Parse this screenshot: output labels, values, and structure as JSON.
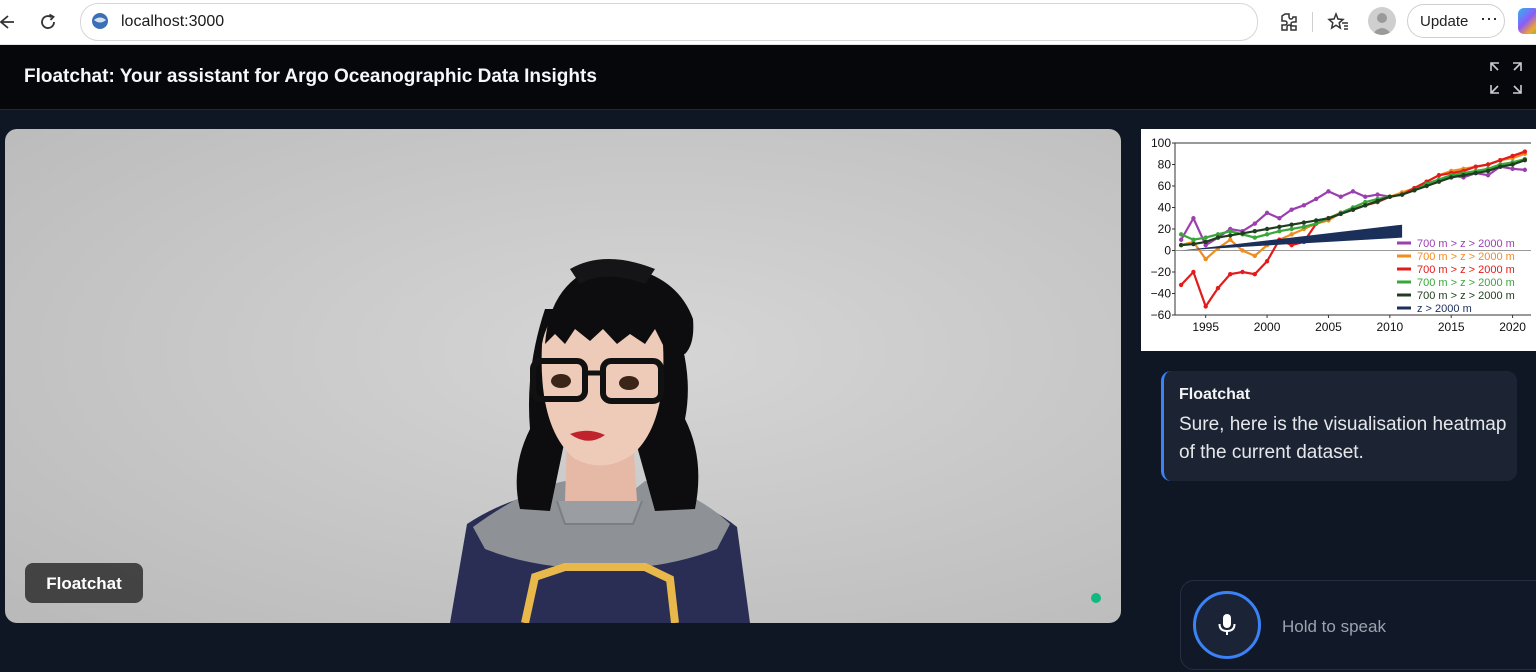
{
  "browser": {
    "url": "localhost:3000",
    "update_label": "Update",
    "more_label": "⋯"
  },
  "app": {
    "title": "Floatchat: Your assistant for Argo Oceanographic Data Insights"
  },
  "avatar": {
    "name_tag": "Floatchat",
    "status_color": "#10b981"
  },
  "chart_data": {
    "type": "line",
    "x": [
      1993,
      1994,
      1995,
      1996,
      1997,
      1998,
      1999,
      2000,
      2001,
      2002,
      2003,
      2004,
      2005,
      2006,
      2007,
      2008,
      2009,
      2010,
      2011,
      2012,
      2013,
      2014,
      2015,
      2016,
      2017,
      2018,
      2019,
      2020,
      2021
    ],
    "xticks": [
      "1995",
      "2000",
      "2005",
      "2010",
      "2015",
      "2020"
    ],
    "xtick_values": [
      1995,
      2000,
      2005,
      2010,
      2015,
      2020
    ],
    "yticks": [
      "100",
      "80",
      "60",
      "40",
      "20",
      "0",
      "−20",
      "−40",
      "−60"
    ],
    "ylim": [
      -60,
      100
    ],
    "xlim": [
      1992.5,
      2021.5
    ],
    "series": [
      {
        "name": "700 m > z > 2000 m",
        "color": "#9b3fb0",
        "values": [
          10,
          30,
          5,
          12,
          20,
          18,
          25,
          35,
          30,
          38,
          42,
          48,
          55,
          50,
          55,
          50,
          52,
          50,
          52,
          58,
          62,
          66,
          70,
          68,
          72,
          70,
          78,
          76,
          75
        ]
      },
      {
        "name": "700 m > z > 2000 m",
        "color": "#f28c1c",
        "values": [
          5,
          8,
          -8,
          2,
          10,
          0,
          -5,
          5,
          10,
          15,
          20,
          25,
          28,
          35,
          38,
          42,
          46,
          50,
          54,
          58,
          64,
          70,
          74,
          76,
          78,
          80,
          84,
          86,
          90
        ]
      },
      {
        "name": "700 m > z > 2000 m",
        "color": "#e21b1b",
        "values": [
          -32,
          -20,
          -52,
          -35,
          -22,
          -20,
          -22,
          -10,
          10,
          5,
          8,
          25,
          30,
          35,
          38,
          42,
          45,
          50,
          52,
          58,
          64,
          70,
          72,
          74,
          78,
          80,
          84,
          88,
          92
        ]
      },
      {
        "name": "700 m > z > 2000 m",
        "color": "#3aa63a",
        "values": [
          15,
          10,
          12,
          15,
          18,
          15,
          12,
          15,
          18,
          20,
          22,
          25,
          30,
          35,
          40,
          45,
          48,
          50,
          52,
          56,
          62,
          66,
          70,
          72,
          74,
          76,
          80,
          82,
          85
        ]
      },
      {
        "name": "700 m > z > 2000 m",
        "color": "#1f3d1f",
        "values": [
          5,
          6,
          8,
          12,
          14,
          16,
          18,
          20,
          22,
          24,
          26,
          28,
          30,
          34,
          38,
          42,
          46,
          50,
          52,
          56,
          60,
          64,
          68,
          70,
          72,
          74,
          78,
          80,
          84
        ]
      },
      {
        "name": "z > 2000 m",
        "color": "#1a2f5a",
        "values": [
          0,
          1,
          2,
          3,
          4,
          5,
          6,
          7,
          8,
          9,
          10,
          11,
          12,
          13,
          14,
          15,
          16,
          17,
          18
        ]
      }
    ],
    "legend_position": "bottom-right",
    "grid": false
  },
  "message": {
    "sender": "Floatchat",
    "text": "Sure, here is the visualisation heatmap of the current dataset."
  },
  "speak": {
    "label": "Hold to speak"
  }
}
